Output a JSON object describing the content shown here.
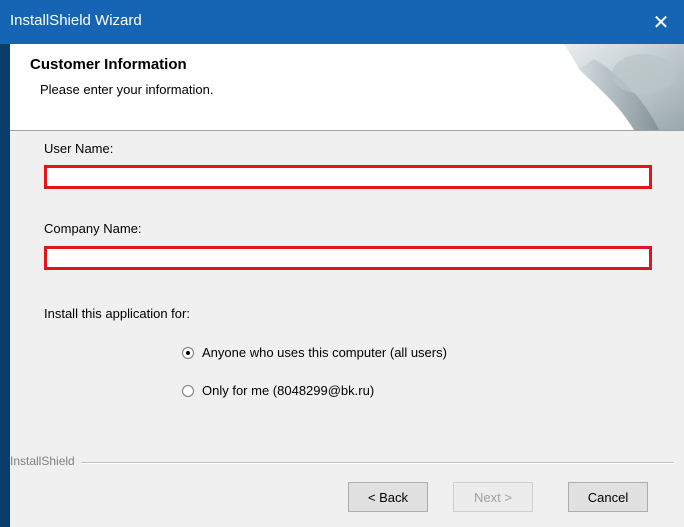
{
  "window": {
    "title": "InstallShield Wizard",
    "close_glyph": "✕"
  },
  "header": {
    "title": "Customer Information",
    "subtitle": "Please enter your information."
  },
  "form": {
    "user_name_label": "User Name:",
    "user_name_value": "",
    "company_name_label": "Company Name:",
    "company_name_value": "",
    "install_for_label": "Install this application for:",
    "options": [
      {
        "label": "Anyone who uses this computer (all users)",
        "selected": true
      },
      {
        "label": "Only for me (8048299@bk.ru)",
        "selected": false
      }
    ]
  },
  "footer": {
    "brand": "InstallShield"
  },
  "buttons": {
    "back": "< Back",
    "next": "Next >",
    "cancel": "Cancel"
  },
  "colors": {
    "titlebar": "#1665b5",
    "highlight": "#e0151e"
  },
  "icons": {
    "close": "close-icon",
    "header_graphic": "page-curl-graphic"
  }
}
